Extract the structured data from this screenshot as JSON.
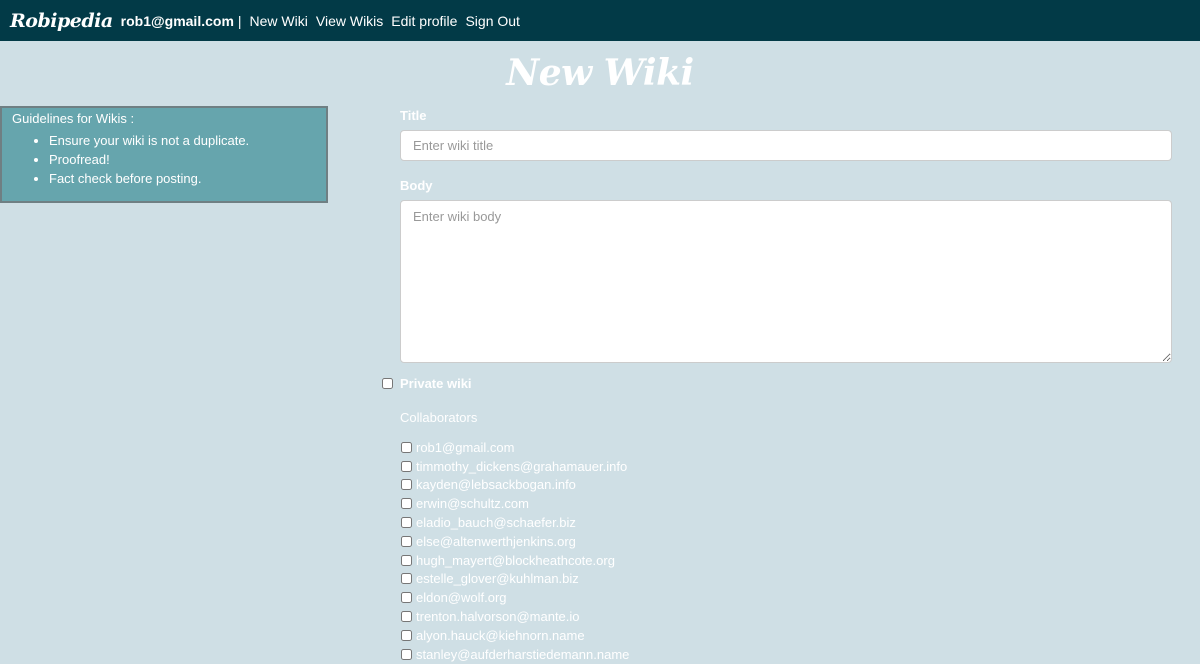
{
  "navbar": {
    "brand": "Robipedia",
    "user_email": "rob1@gmail.com",
    "separator": "|",
    "links": [
      "New Wiki",
      "View Wikis",
      "Edit profile",
      "Sign Out"
    ]
  },
  "page": {
    "title": "New Wiki"
  },
  "guidelines": {
    "title": "Guidelines for Wikis :",
    "items": [
      "Ensure your wiki is not a duplicate.",
      "Proofread!",
      "Fact check before posting."
    ]
  },
  "form": {
    "title_label": "Title",
    "title_placeholder": "Enter wiki title",
    "title_value": "",
    "body_label": "Body",
    "body_placeholder": "Enter wiki body",
    "body_value": "",
    "private_label": "Private wiki",
    "private_checked": false,
    "collaborators_label": "Collaborators",
    "collaborators": [
      "rob1@gmail.com",
      "timmothy_dickens@grahamauer.info",
      "kayden@lebsackbogan.info",
      "erwin@schultz.com",
      "eladio_bauch@schaefer.biz",
      "else@altenwerthjenkins.org",
      "hugh_mayert@blockheathcote.org",
      "estelle_glover@kuhlman.biz",
      "eldon@wolf.org",
      "trenton.halvorson@mante.io",
      "alyon.hauck@kiehnorn.name",
      "stanley@aufderharstiedemann.name"
    ]
  },
  "colors": {
    "navbar_bg": "#023a47",
    "page_bg": "#cfdfe5",
    "guidelines_bg": "#66a5ad"
  }
}
